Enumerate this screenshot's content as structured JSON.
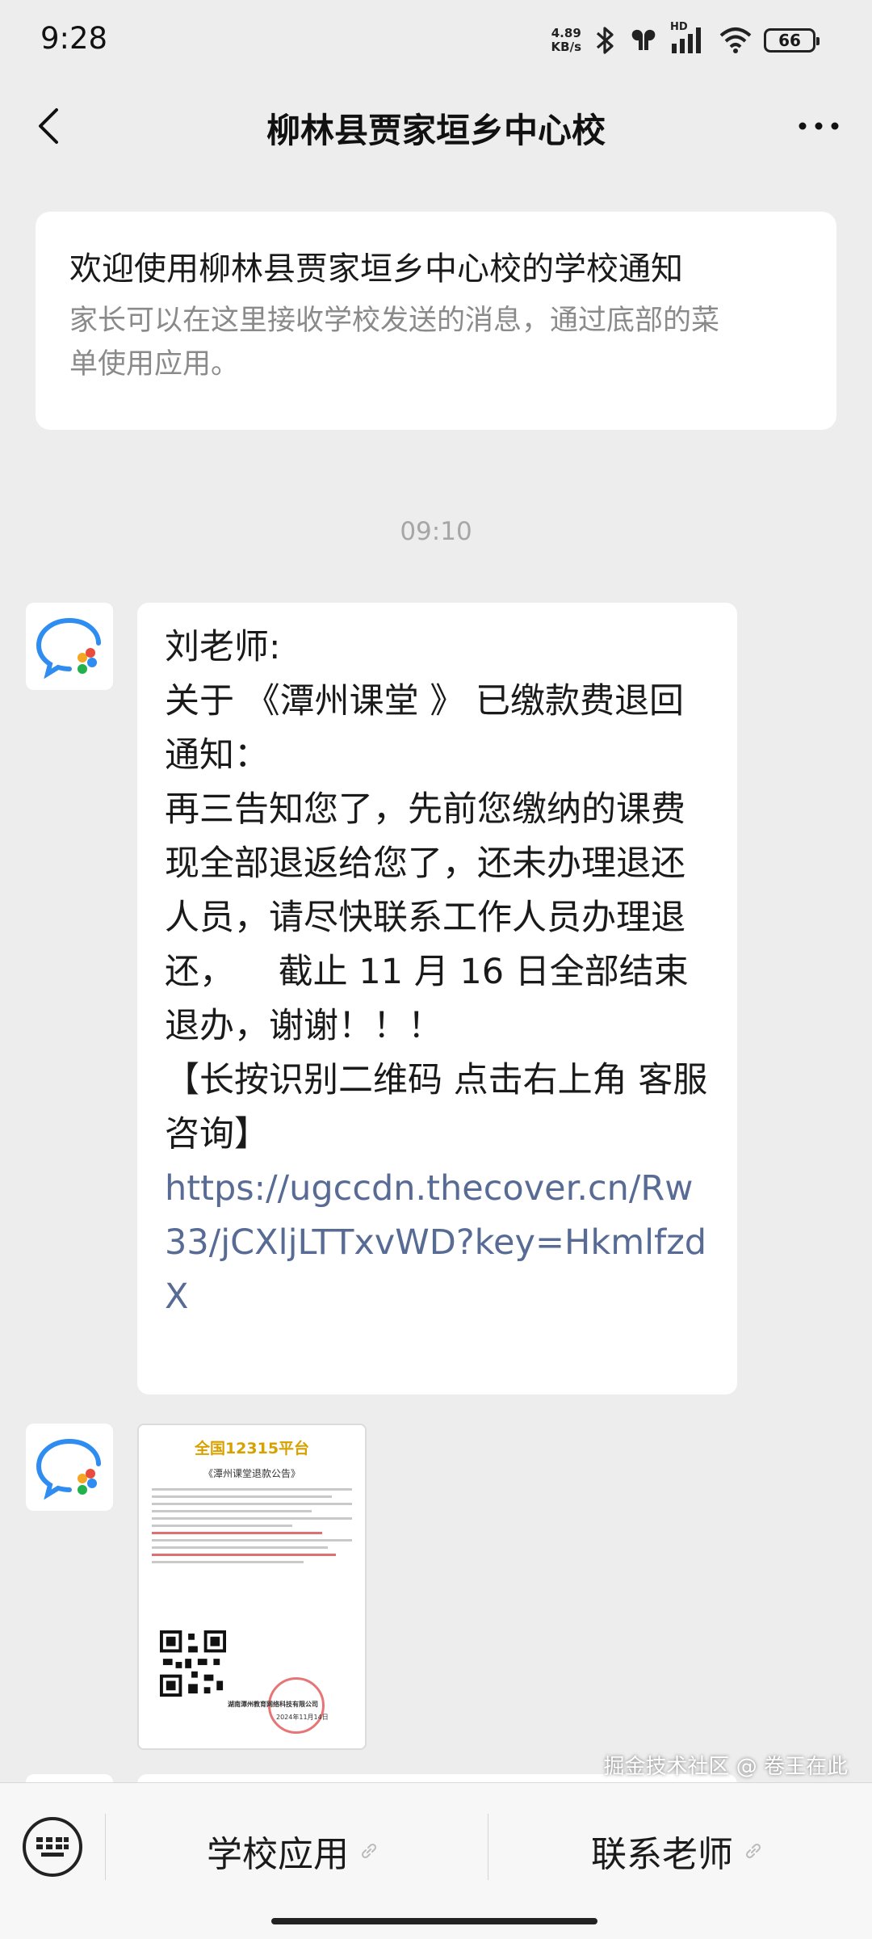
{
  "status_bar": {
    "time": "9:28",
    "net_speed_value": "4.89",
    "net_speed_unit": "KB/s",
    "network_badge": "HD",
    "battery": "66",
    "icons": [
      "bluetooth-icon",
      "earbuds-icon",
      "signal-icon",
      "wifi-icon",
      "battery-icon"
    ]
  },
  "header": {
    "title": "柳林县贾家垣乡中心校",
    "back_icon": "chevron-left-icon",
    "more_icon": "more-horizontal-icon"
  },
  "welcome": {
    "title": "欢迎使用柳林县贾家垣乡中心校的学校通知",
    "description_line1": "家长可以在这里接收学校发送的消息，通过底部的菜",
    "description_line2": "单使用应用。"
  },
  "timestamp": "09:10",
  "message": {
    "sender_line": "刘老师:",
    "body": "关于 《潭州课堂 》 已缴款费退回通知：\n再三告知您了，先前您缴纳的课费现全部退返给您了，还未办理退还人员，请尽快联系工作人员办理退还，    截止 11 月 16 日全部结束退办，谢谢！！！\n【长按识别二维码 点击右上角 客服咨询】\n",
    "link": "https://ugccdn.thecover.cn/Rw33/jCXljLTTxvWD?key=HkmlfzdX"
  },
  "image_message": {
    "brand": "全国12315平台",
    "heading": "《潭州课堂退款公告》",
    "company": "湖南潭州教育网络科技有限公司",
    "date": "2024年11月14日"
  },
  "bottom_menu": {
    "keyboard_icon": "keyboard-icon",
    "item1": "学校应用",
    "item2": "联系老师",
    "item_icon": "link-icon"
  },
  "watermark": "掘金技术社区 @ 卷王在此",
  "colors": {
    "background": "#ededed",
    "link": "#576b95",
    "muted": "#8a8a8a"
  }
}
